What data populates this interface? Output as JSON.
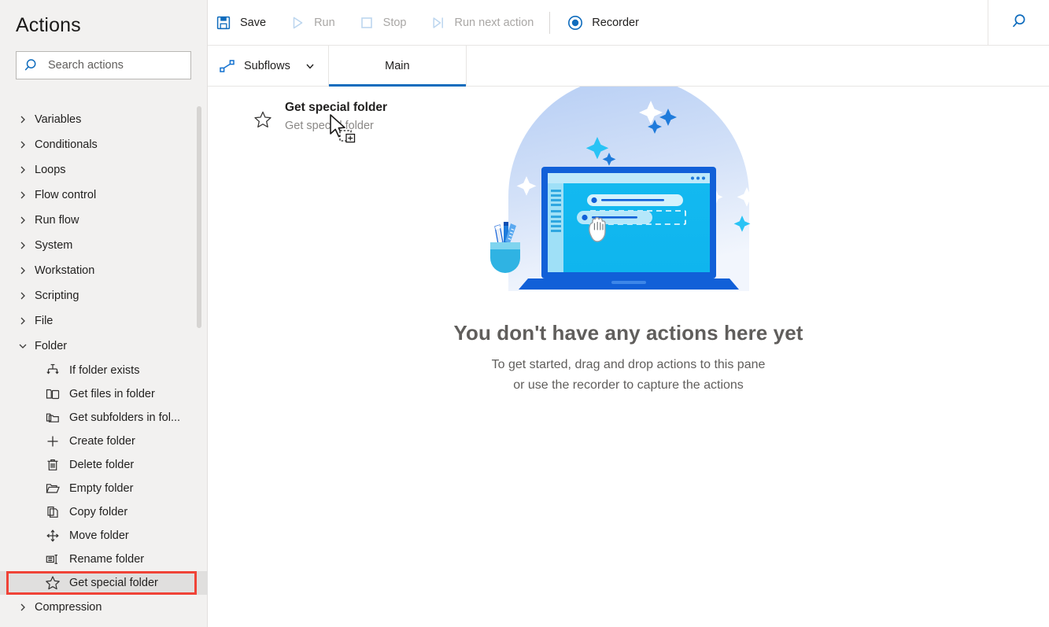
{
  "sidebar": {
    "title": "Actions",
    "search": {
      "placeholder": "Search actions",
      "value": "",
      "icon": "search-icon"
    },
    "categories": [
      {
        "label": "Variables",
        "expanded": false,
        "icon": "chevron-right-icon"
      },
      {
        "label": "Conditionals",
        "expanded": false,
        "icon": "chevron-right-icon"
      },
      {
        "label": "Loops",
        "expanded": false,
        "icon": "chevron-right-icon"
      },
      {
        "label": "Flow control",
        "expanded": false,
        "icon": "chevron-right-icon"
      },
      {
        "label": "Run flow",
        "expanded": false,
        "icon": "chevron-right-icon"
      },
      {
        "label": "System",
        "expanded": false,
        "icon": "chevron-right-icon"
      },
      {
        "label": "Workstation",
        "expanded": false,
        "icon": "chevron-right-icon"
      },
      {
        "label": "Scripting",
        "expanded": false,
        "icon": "chevron-right-icon"
      },
      {
        "label": "File",
        "expanded": false,
        "icon": "chevron-right-icon"
      },
      {
        "label": "Folder",
        "expanded": true,
        "icon": "chevron-down-icon"
      },
      {
        "label": "Compression",
        "expanded": false,
        "icon": "chevron-right-icon"
      }
    ],
    "folder_actions": [
      {
        "label": "If folder exists",
        "icon": "branch-icon",
        "selected": false
      },
      {
        "label": "Get files in folder",
        "icon": "folder-files-icon",
        "selected": false
      },
      {
        "label": "Get subfolders in fol...",
        "icon": "folder-stack-icon",
        "selected": false
      },
      {
        "label": "Create folder",
        "icon": "plus-icon",
        "selected": false
      },
      {
        "label": "Delete folder",
        "icon": "trash-icon",
        "selected": false
      },
      {
        "label": "Empty folder",
        "icon": "open-folder-icon",
        "selected": false
      },
      {
        "label": "Copy folder",
        "icon": "copy-icon",
        "selected": false
      },
      {
        "label": "Move folder",
        "icon": "move-arrows-icon",
        "selected": false
      },
      {
        "label": "Rename folder",
        "icon": "rename-icon",
        "selected": false
      },
      {
        "label": "Get special folder",
        "icon": "star-icon",
        "selected": true
      }
    ],
    "scrollbar": {
      "name": "sidebar-scrollbar"
    }
  },
  "toolbar": {
    "save_label": "Save",
    "run_label": "Run",
    "stop_label": "Stop",
    "run_next_label": "Run next action",
    "recorder_label": "Recorder",
    "search_icon": "search-icon",
    "icons": {
      "save": "save-floppy-icon",
      "run": "play-triangle-icon",
      "stop": "stop-square-icon",
      "run_next": "step-over-icon",
      "recorder": "record-circle-icon"
    }
  },
  "tabsbar": {
    "subflows_label": "Subflows",
    "subflows_icon": "subflow-nodes-icon",
    "subflows_chevron": "chevron-down-icon",
    "tabs": [
      {
        "label": "Main",
        "active": true
      }
    ]
  },
  "canvas": {
    "drag_ghost": {
      "title": "Get special folder",
      "subtitle": "Get special folder",
      "icon": "star-icon",
      "cursor": "drag-copy-cursor"
    },
    "empty_state": {
      "title": "You don't have any actions here yet",
      "line1": "To get started, drag and drop actions to this pane",
      "line2": "or use the recorder to capture the actions",
      "illustration": "drag-drop-laptop-illustration"
    }
  },
  "annotation": {
    "highlight_color": "#f04337",
    "target": "Get special folder"
  },
  "colors": {
    "accent": "#0f6cbd",
    "sidebar_bg": "#f2f1f0",
    "canvas_bg": "#ffffff",
    "text": "#201f1e",
    "muted_text": "#605e5c",
    "disabled_text": "#a9a7a5"
  }
}
